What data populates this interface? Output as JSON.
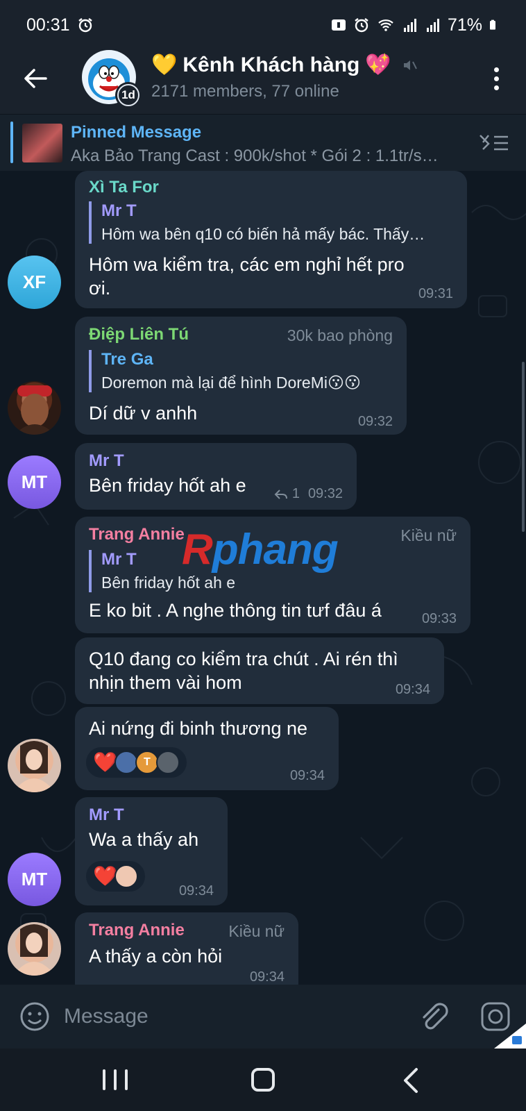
{
  "status_bar": {
    "time": "00:31",
    "battery": "71%"
  },
  "header": {
    "title": "Kênh Khách hàng",
    "title_prefix_emoji": "💛",
    "title_suffix_emoji": "💖",
    "badge": "1d",
    "subtitle": "2171 members, 77 online",
    "icons": [
      "back-arrow-icon",
      "muted-icon",
      "more-vertical-icon"
    ]
  },
  "pinned": {
    "title": "Pinned Message",
    "text": "Aka Bảo Trang  Cast : 900k/shot * Gói 2 : 1.1tr/s…"
  },
  "messages": [
    {
      "author": "Xì Ta For",
      "author_color": "#6ad9c9",
      "avatar_initials": "XF",
      "reply_to": "Mr T",
      "reply_text": "Hôm wa bên q10 có biến hả mấy bác. Thấy…",
      "text": "Hôm wa kiểm tra, các em nghỉ hết pro ơi.",
      "time": "09:31"
    },
    {
      "author": "Điệp Liên Tú",
      "author_color": "#7dd874",
      "rank": "30k bao phòng",
      "reply_to": "Tre Ga",
      "reply_text": "Doremon mà lại để hình DoreMi😗😗",
      "text": "Dí dữ v anhh",
      "time": "09:32"
    },
    {
      "author": "Mr T",
      "author_color": "#a29bfe",
      "avatar_initials": "MT",
      "text": "Bên friday hốt ah e",
      "replies": "1",
      "time": "09:32"
    },
    {
      "author": "Trang Annie",
      "author_color": "#f47fa1",
      "rank": "Kiều nữ",
      "reply_to": "Mr T",
      "reply_text": "Bên friday hốt ah e",
      "text": "E ko bit . A nghe thông tin tưf đâu á",
      "time": "09:33"
    },
    {
      "text": "Q10 đang co kiểm tra chút . Ai rén thì nhịn them vài hom",
      "time": "09:34"
    },
    {
      "text": "Ai nứng đi binh thương ne",
      "time": "09:34",
      "reaction": "❤️"
    },
    {
      "author": "Mr T",
      "author_color": "#a29bfe",
      "avatar_initials": "MT",
      "text": "Wa a thấy ah",
      "time": "09:34",
      "reaction": "❤️"
    },
    {
      "author": "Trang Annie",
      "author_color": "#f47fa1",
      "rank": "Kiều nữ",
      "text": "A thấy a còn hỏi",
      "time": "09:34"
    }
  ],
  "reaction_avatar_initial": "T",
  "watermark": {
    "first": "R",
    "rest": "phang"
  },
  "input": {
    "placeholder": "Message"
  }
}
